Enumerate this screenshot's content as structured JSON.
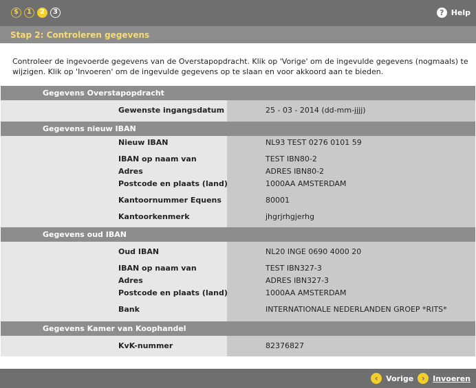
{
  "steps": [
    "$",
    "1",
    "2",
    "3"
  ],
  "help": {
    "label": "Help"
  },
  "subbar": {
    "title": "Stap 2: Controleren gegevens"
  },
  "intro": "Controleer de ingevoerde gegevens van de Overstapopdracht. Klik op 'Vorige' om de ingevulde gegevens (nogmaals) te wijzigen. Klik op 'Invoeren' om de ingevulde gegevens op te slaan en voor akkoord aan te bieden.",
  "sections": {
    "overstap": {
      "title": "Gegevens Overstapopdracht",
      "rows": [
        {
          "label": "Gewenste ingangsdatum",
          "value": "25 - 03 - 2014 (dd-mm-jjjj)"
        }
      ]
    },
    "nieuw": {
      "title": "Gegevens nieuw IBAN",
      "rows": [
        {
          "label": "Nieuw IBAN",
          "value": "NL93 TEST 0276 0101 59"
        },
        {
          "label": "IBAN op naam van",
          "value": "TEST IBN80-2"
        },
        {
          "label": "Adres",
          "value": "ADRES IBN80-2"
        },
        {
          "label": "Postcode en plaats (land)",
          "value": "1000AA AMSTERDAM"
        },
        {
          "label": "Kantoornummer Equens",
          "value": "80001"
        },
        {
          "label": "Kantoorkenmerk",
          "value": "jhgrjrhgjerhg"
        }
      ]
    },
    "oud": {
      "title": "Gegevens oud IBAN",
      "rows": [
        {
          "label": "Oud IBAN",
          "value": "NL20 INGE 0690 4000 20"
        },
        {
          "label": "IBAN op naam van",
          "value": "TEST IBN327-3"
        },
        {
          "label": "Adres",
          "value": "ADRES IBN327-3"
        },
        {
          "label": "Postcode en plaats (land)",
          "value": "1000AA AMSTERDAM"
        },
        {
          "label": "Bank",
          "value": "INTERNATIONALE NEDERLANDEN GROEP *RITS*"
        }
      ]
    },
    "kvk": {
      "title": "Gegevens Kamer van Koophandel",
      "rows": [
        {
          "label": "KvK-nummer",
          "value": "82376827"
        }
      ]
    }
  },
  "nav": {
    "prev": "Vorige",
    "next": "Invoeren"
  },
  "colors": {
    "bar": "#6f6f6f",
    "section": "#8d8d8d",
    "accent": "#f4cf2a",
    "title_text": "#f7dc73"
  }
}
